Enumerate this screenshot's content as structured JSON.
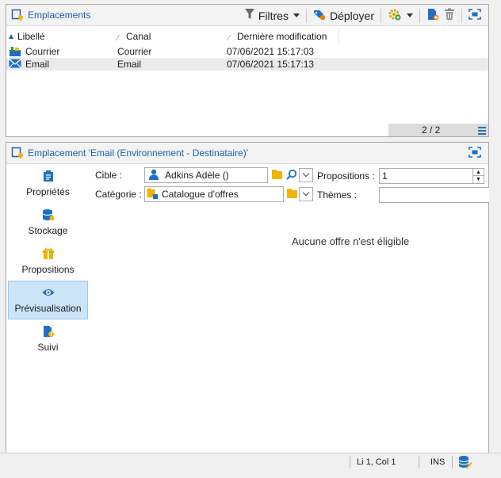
{
  "top_panel": {
    "title": "Emplacements",
    "toolbar": {
      "filters_label": "Filtres",
      "deploy_label": "Déployer"
    },
    "columns": [
      "Libellé",
      "Canal",
      "Dernière modification"
    ],
    "rows": [
      {
        "label": "Courrier",
        "channel": "Courrier",
        "modified": "07/06/2021 15:17:03",
        "icon": "mail-box-icon"
      },
      {
        "label": "Email",
        "channel": "Email",
        "modified": "07/06/2021 15:17:13",
        "icon": "envelope-icon"
      }
    ],
    "pagination": "2 / 2"
  },
  "bottom_panel": {
    "title": "Emplacement 'Email (Environnement - Destinataire)'",
    "sidebar": [
      {
        "label": "Propriétés",
        "icon": "properties-icon"
      },
      {
        "label": "Stockage",
        "icon": "storage-icon"
      },
      {
        "label": "Propositions",
        "icon": "propositions-icon"
      },
      {
        "label": "Prévisualisation",
        "icon": "eye-icon",
        "active": true
      },
      {
        "label": "Suivi",
        "icon": "tracking-icon"
      }
    ],
    "form": {
      "target_label": "Cible :",
      "target_value": "Adkins Adèle ()",
      "category_label": "Catégorie :",
      "category_value": "Catalogue d'offres",
      "propositions_label": "Propositions :",
      "propositions_value": "1",
      "themes_label": "Thèmes :",
      "themes_value": ""
    },
    "empty_message": "Aucune offre n'est éligible"
  },
  "statusbar": {
    "position": "Li 1, Col 1",
    "mode": "INS"
  },
  "colors": {
    "accent": "#1f5fa8",
    "selection": "#cce4f7",
    "folder": "#f0b400"
  }
}
